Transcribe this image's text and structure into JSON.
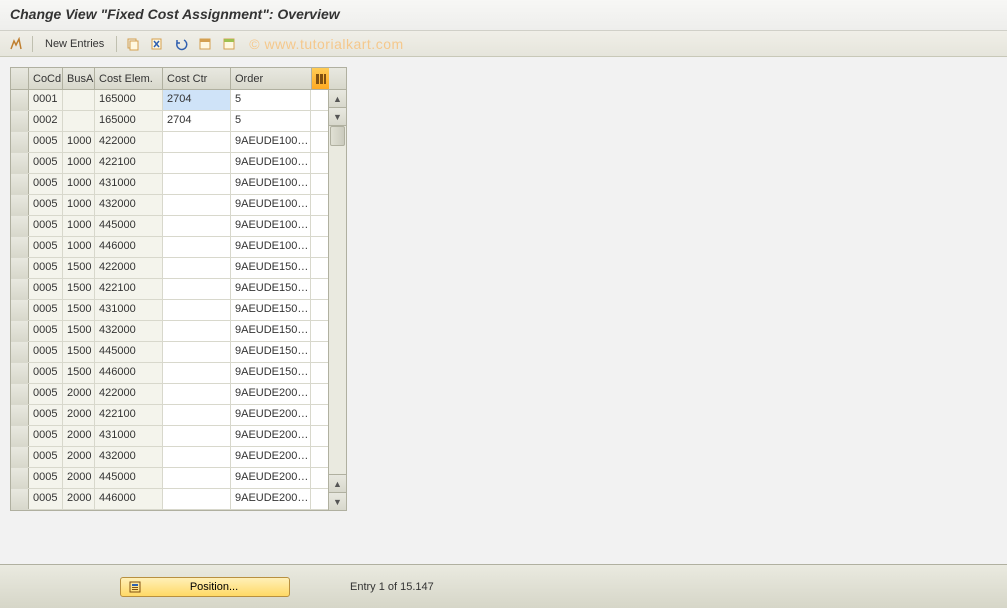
{
  "title": "Change View \"Fixed Cost Assignment\": Overview",
  "toolbar": {
    "new_entries_label": "New Entries"
  },
  "watermark": "© www.tutorialkart.com",
  "table": {
    "headers": {
      "cocd": "CoCd",
      "busa": "BusA",
      "cost_elem": "Cost Elem.",
      "cost_ctr": "Cost Ctr",
      "order": "Order"
    },
    "rows": [
      {
        "cocd": "0001",
        "busa": "",
        "cost_elem": "165000",
        "cost_ctr": "2704",
        "order": "5",
        "sel": true
      },
      {
        "cocd": "0002",
        "busa": "",
        "cost_elem": "165000",
        "cost_ctr": "2704",
        "order": "5"
      },
      {
        "cocd": "0005",
        "busa": "1000",
        "cost_elem": "422000",
        "cost_ctr": "",
        "order": "9AEUDE100…"
      },
      {
        "cocd": "0005",
        "busa": "1000",
        "cost_elem": "422100",
        "cost_ctr": "",
        "order": "9AEUDE100…"
      },
      {
        "cocd": "0005",
        "busa": "1000",
        "cost_elem": "431000",
        "cost_ctr": "",
        "order": "9AEUDE100…"
      },
      {
        "cocd": "0005",
        "busa": "1000",
        "cost_elem": "432000",
        "cost_ctr": "",
        "order": "9AEUDE100…"
      },
      {
        "cocd": "0005",
        "busa": "1000",
        "cost_elem": "445000",
        "cost_ctr": "",
        "order": "9AEUDE100…"
      },
      {
        "cocd": "0005",
        "busa": "1000",
        "cost_elem": "446000",
        "cost_ctr": "",
        "order": "9AEUDE100…"
      },
      {
        "cocd": "0005",
        "busa": "1500",
        "cost_elem": "422000",
        "cost_ctr": "",
        "order": "9AEUDE150…"
      },
      {
        "cocd": "0005",
        "busa": "1500",
        "cost_elem": "422100",
        "cost_ctr": "",
        "order": "9AEUDE150…"
      },
      {
        "cocd": "0005",
        "busa": "1500",
        "cost_elem": "431000",
        "cost_ctr": "",
        "order": "9AEUDE150…"
      },
      {
        "cocd": "0005",
        "busa": "1500",
        "cost_elem": "432000",
        "cost_ctr": "",
        "order": "9AEUDE150…"
      },
      {
        "cocd": "0005",
        "busa": "1500",
        "cost_elem": "445000",
        "cost_ctr": "",
        "order": "9AEUDE150…"
      },
      {
        "cocd": "0005",
        "busa": "1500",
        "cost_elem": "446000",
        "cost_ctr": "",
        "order": "9AEUDE150…"
      },
      {
        "cocd": "0005",
        "busa": "2000",
        "cost_elem": "422000",
        "cost_ctr": "",
        "order": "9AEUDE200…"
      },
      {
        "cocd": "0005",
        "busa": "2000",
        "cost_elem": "422100",
        "cost_ctr": "",
        "order": "9AEUDE200…"
      },
      {
        "cocd": "0005",
        "busa": "2000",
        "cost_elem": "431000",
        "cost_ctr": "",
        "order": "9AEUDE200…"
      },
      {
        "cocd": "0005",
        "busa": "2000",
        "cost_elem": "432000",
        "cost_ctr": "",
        "order": "9AEUDE200…"
      },
      {
        "cocd": "0005",
        "busa": "2000",
        "cost_elem": "445000",
        "cost_ctr": "",
        "order": "9AEUDE200…"
      },
      {
        "cocd": "0005",
        "busa": "2000",
        "cost_elem": "446000",
        "cost_ctr": "",
        "order": "9AEUDE200…"
      }
    ]
  },
  "dialog": {
    "position_label": "Position...",
    "entry_status": "Entry 1 of 15.147"
  }
}
